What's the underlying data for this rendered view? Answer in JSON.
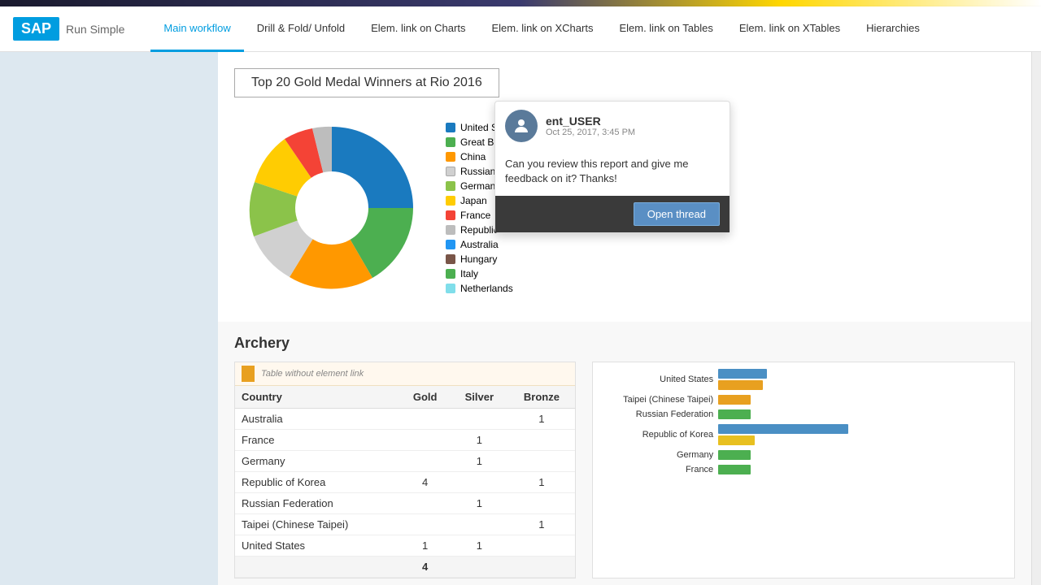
{
  "topbar": {
    "logo": "SAP",
    "tagline": "Run Simple"
  },
  "nav": {
    "tabs": [
      {
        "id": "main-workflow",
        "label": "Main workflow",
        "active": true
      },
      {
        "id": "drill-fold",
        "label": "Drill & Fold/ Unfold",
        "active": false
      },
      {
        "id": "elem-link-charts",
        "label": "Elem. link on Charts",
        "active": false
      },
      {
        "id": "elem-link-xcharts",
        "label": "Elem. link on XCharts",
        "active": false
      },
      {
        "id": "elem-link-tables",
        "label": "Elem. link on Tables",
        "active": false
      },
      {
        "id": "elem-link-xtables",
        "label": "Elem. link on XTables",
        "active": false
      },
      {
        "id": "hierarchies",
        "label": "Hierarchies",
        "active": false
      }
    ]
  },
  "chart": {
    "title": "Top 20 Gold Medal Winners at Rio 2016",
    "legend": [
      {
        "label": "United States",
        "color": "#1a7abf"
      },
      {
        "label": "Great Britain",
        "color": "#4caf50"
      },
      {
        "label": "China",
        "color": "#ff9800"
      },
      {
        "label": "Russian Federation",
        "color": "#e0e0e0"
      },
      {
        "label": "Germany",
        "color": "#8bc34a"
      },
      {
        "label": "Japan",
        "color": "#ffcc02"
      },
      {
        "label": "France",
        "color": "#f44336"
      },
      {
        "label": "Republic of Korea",
        "color": "#bdbdbd"
      },
      {
        "label": "Australia",
        "color": "#2196f3"
      },
      {
        "label": "Hungary",
        "color": "#795548"
      },
      {
        "label": "Italy",
        "color": "#4caf50"
      },
      {
        "label": "Netherlands",
        "color": "#80deea"
      }
    ],
    "pie_slices": [
      {
        "country": "United States",
        "value": 46,
        "color": "#1a7abf",
        "startAngle": 0,
        "endAngle": 120
      },
      {
        "country": "Great Britain",
        "value": 27,
        "color": "#4caf50",
        "startAngle": 120,
        "endAngle": 175
      },
      {
        "country": "China",
        "value": 26,
        "color": "#ff9800",
        "startAngle": 175,
        "endAngle": 228
      },
      {
        "country": "Russian Federation",
        "value": 19,
        "color": "#e0e0e0",
        "startAngle": 228,
        "endAngle": 265
      },
      {
        "country": "Germany",
        "value": 17,
        "color": "#8bc34a",
        "startAngle": 265,
        "endAngle": 297
      },
      {
        "country": "Japan",
        "value": 12,
        "color": "#ffcc02",
        "startAngle": 297,
        "endAngle": 323
      },
      {
        "country": "France",
        "value": 10,
        "color": "#f44336",
        "startAngle": 323,
        "endAngle": 343
      },
      {
        "country": "Republic of Korea",
        "value": 9,
        "color": "#bdbdbd",
        "startAngle": 343,
        "endAngle": 360
      }
    ]
  },
  "comment_popup": {
    "username": "ent_USER",
    "datetime": "Oct 25, 2017, 3:45 PM",
    "message": "Can you review this report and give me feedback on it? Thanks!",
    "open_thread_label": "Open thread"
  },
  "archery": {
    "section_title": "Archery",
    "table_hint": "Table without element link",
    "columns": [
      "Country",
      "Gold",
      "Silver",
      "Bronze"
    ],
    "rows": [
      {
        "country": "Australia",
        "gold": "",
        "silver": "",
        "bronze": "1"
      },
      {
        "country": "France",
        "gold": "",
        "silver": "1",
        "bronze": ""
      },
      {
        "country": "Germany",
        "gold": "",
        "silver": "1",
        "bronze": ""
      },
      {
        "country": "Republic of Korea",
        "gold": "4",
        "silver": "",
        "bronze": "1"
      },
      {
        "country": "Russian Federation",
        "gold": "",
        "silver": "1",
        "bronze": ""
      },
      {
        "country": "Taipei (Chinese Taipei)",
        "gold": "",
        "silver": "",
        "bronze": "1"
      },
      {
        "country": "United States",
        "gold": "1",
        "silver": "1",
        "bronze": ""
      }
    ],
    "table_total": "4",
    "bar_chart": {
      "countries": [
        {
          "name": "United States",
          "gold": 60,
          "silver": 40,
          "bronze": 0
        },
        {
          "name": "Taipei (Chinese Taipei)",
          "gold": 0,
          "silver": 35,
          "bronze": 0
        },
        {
          "name": "Russian Federation",
          "gold": 40,
          "silver": 0,
          "bronze": 0
        },
        {
          "name": "Republic of Korea",
          "gold": 140,
          "silver": 0,
          "bronze": 45
        },
        {
          "name": "Germany",
          "gold": 40,
          "silver": 0,
          "bronze": 0
        },
        {
          "name": "France",
          "gold": 40,
          "silver": 0,
          "bronze": 0
        }
      ],
      "colors": {
        "gold": "#e8a020",
        "silver": "#4a8fc4",
        "bronze": "#e8c020"
      }
    }
  }
}
